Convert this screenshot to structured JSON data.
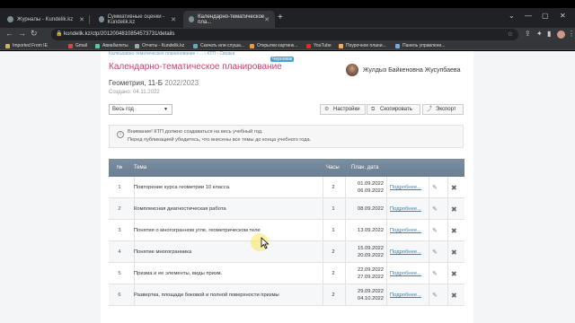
{
  "browser": {
    "tabs": [
      {
        "label": "Журналы - Kundelik.kz"
      },
      {
        "label": "Суммативные оценки - Kundelik.kz"
      },
      {
        "label": "Календарно-тематическое пла..."
      }
    ],
    "url": "kundelik.kz/ctp/2012004810854573731/details",
    "bookmarks": [
      "Imported From IE",
      "Gmail",
      "Авиабилеты",
      "Отчеты - Kundelik.kz",
      "Скачать или слуша...",
      "Открытки картинк...",
      "YouTube",
      "Поурочное плани...",
      "Панель управлени..."
    ]
  },
  "page": {
    "breadcrumb": "Календарно-тематическое планирование › ... › КТП › Сводка",
    "draft_badge": "Черновик",
    "title": "Календарно-тематическое планирование",
    "teacher": "Жулдыз Байкеновна Жусупбаева",
    "subject": "Геометрия, 11-Б",
    "year": "2022/2023",
    "created": "Создано: 04.11.2022",
    "period_select": "Весь год",
    "buttons": {
      "settings": "Настройки",
      "copy": "Скопировать",
      "export": "Экспорт"
    },
    "notice_line1": "Внимание! КТП должно создаваться на весь учебный год.",
    "notice_line2": "Перед публикацией убедитесь, что внесены все темы до конца учебного года."
  },
  "table": {
    "headers": {
      "num": "№",
      "topic": "Тема",
      "hours": "Часы",
      "date": "План. дата"
    },
    "more_label": "Подробнее...",
    "rows": [
      {
        "num": "1",
        "topic": "Повторение курса геометрии 10 класса.",
        "hours": "2",
        "date1": "01.09.2022",
        "date2": "06.09.2022"
      },
      {
        "num": "2",
        "topic": "Комплексная диагностическая работа",
        "hours": "1",
        "date1": "08.09.2022",
        "date2": ""
      },
      {
        "num": "3",
        "topic": "Понятия о многогранном угле, геометрическом теле",
        "hours": "1",
        "date1": "13.09.2022",
        "date2": ""
      },
      {
        "num": "4",
        "topic": "Понятие многогранника",
        "hours": "2",
        "date1": "15.09.2022",
        "date2": "20.09.2022"
      },
      {
        "num": "5",
        "topic": "Призма и ее элементы, виды призм.",
        "hours": "2",
        "date1": "22.09.2022",
        "date2": "27.09.2022"
      },
      {
        "num": "6",
        "topic": "Развертка, площади боковой и полной поверхности призмы",
        "hours": "2",
        "date1": "29.09.2022",
        "date2": "04.10.2022"
      }
    ]
  }
}
